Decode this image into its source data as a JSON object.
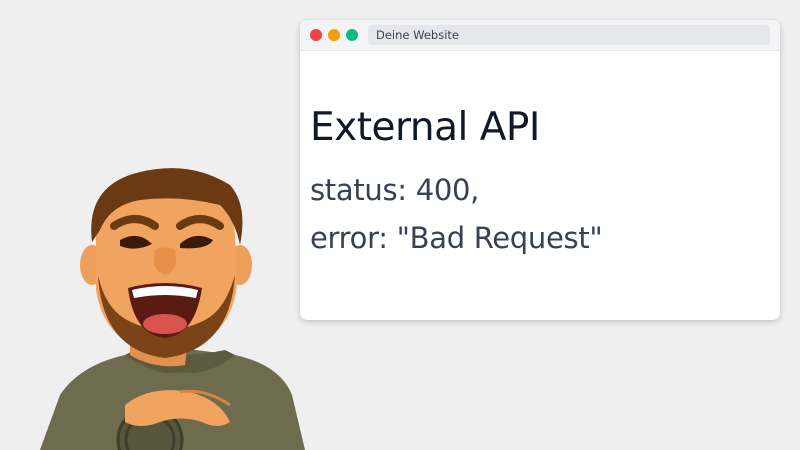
{
  "browser": {
    "address": "Deine Website",
    "window_controls": {
      "close_color": "#ef4444",
      "minimize_color": "#f59e0b",
      "maximize_color": "#10b981"
    }
  },
  "page": {
    "heading": "External API",
    "response": {
      "status_line": "status: 400,",
      "error_line": "error: \"Bad Request\""
    }
  },
  "avatar": {
    "description_icon": "smiling-bearded-man-avatar-icon",
    "shirt_color": "#6e6b4f",
    "skin_color": "#f0a460",
    "hair_color": "#6b3a12"
  }
}
